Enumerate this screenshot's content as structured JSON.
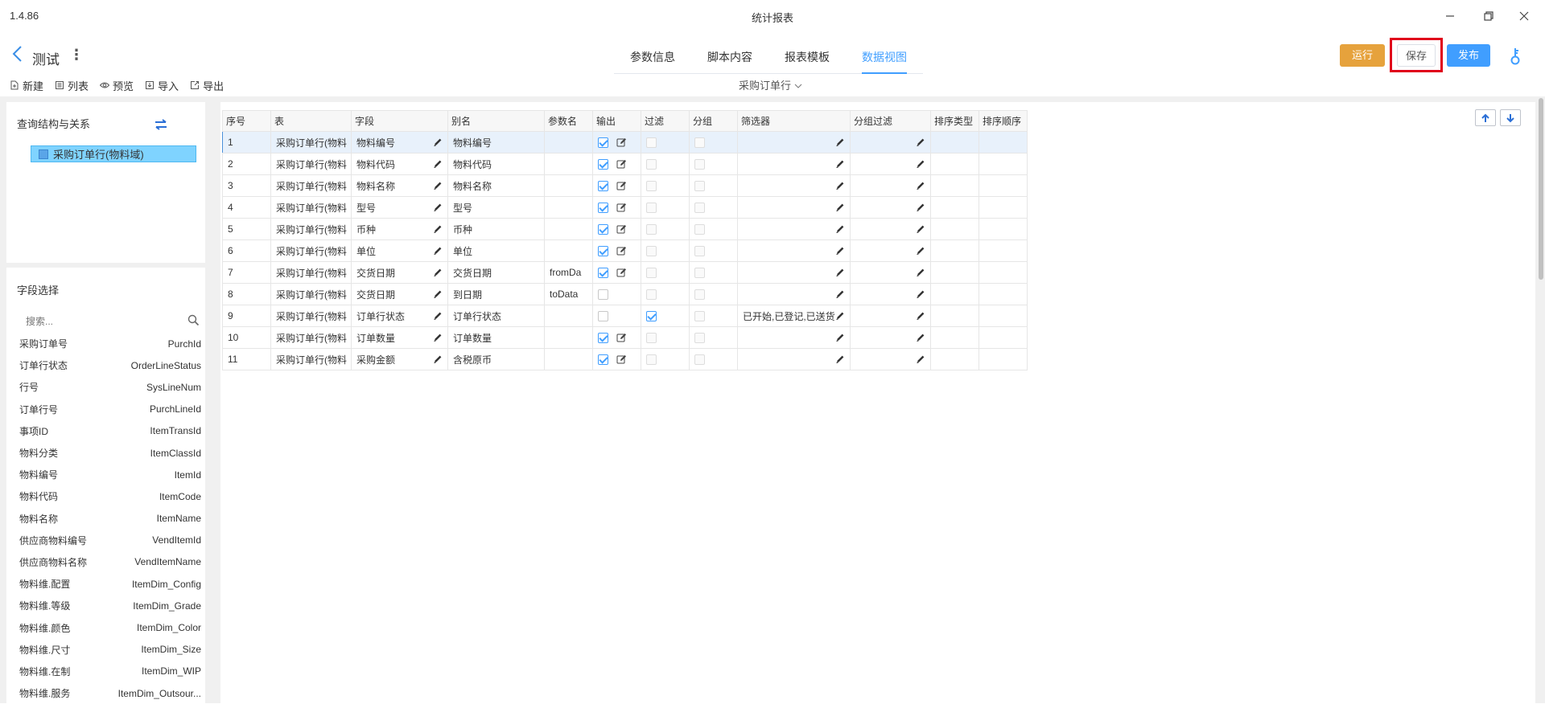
{
  "window": {
    "version": "1.4.86",
    "title": "统计报表"
  },
  "header": {
    "report_name": "测试",
    "tabs": [
      "参数信息",
      "脚本内容",
      "报表模板",
      "数据视图"
    ],
    "active_tab": "数据视图",
    "run_label": "运行",
    "save_label": "保存",
    "publish_label": "发布"
  },
  "toolbar": {
    "new": "新建",
    "list": "列表",
    "preview": "预览",
    "import": "导入",
    "export": "导出"
  },
  "view_select": "采购订单行",
  "left": {
    "query_title": "查询结构与关系",
    "tree_node": "采购订单行(物料域)",
    "field_title": "字段选择",
    "search_placeholder": "搜索...",
    "fields": [
      [
        "采购订单号",
        "PurchId"
      ],
      [
        "订单行状态",
        "OrderLineStatus"
      ],
      [
        "行号",
        "SysLineNum"
      ],
      [
        "订单行号",
        "PurchLineId"
      ],
      [
        "事项ID",
        "ItemTransId"
      ],
      [
        "物料分类",
        "ItemClassId"
      ],
      [
        "物料编号",
        "ItemId"
      ],
      [
        "物料代码",
        "ItemCode"
      ],
      [
        "物料名称",
        "ItemName"
      ],
      [
        "供应商物料编号",
        "VendItemId"
      ],
      [
        "供应商物料名称",
        "VendItemName"
      ],
      [
        "物料维.配置",
        "ItemDim_Config"
      ],
      [
        "物料维.等级",
        "ItemDim_Grade"
      ],
      [
        "物料维.颜色",
        "ItemDim_Color"
      ],
      [
        "物料维.尺寸",
        "ItemDim_Size"
      ],
      [
        "物料维.在制",
        "ItemDim_WIP"
      ],
      [
        "物料维.服务",
        "ItemDim_Outsour..."
      ]
    ]
  },
  "grid": {
    "columns": [
      "序号",
      "表",
      "字段",
      "别名",
      "参数名",
      "输出",
      "过滤",
      "分组",
      "筛选器",
      "分组过滤",
      "排序类型",
      "排序顺序"
    ],
    "rows": [
      {
        "no": "1",
        "table": "采购订单行(物料",
        "field": "物料编号",
        "alias": "物料编号",
        "param": "",
        "output": true,
        "filter": false,
        "group": false,
        "filterval": ""
      },
      {
        "no": "2",
        "table": "采购订单行(物料",
        "field": "物料代码",
        "alias": "物料代码",
        "param": "",
        "output": true,
        "filter": false,
        "group": false,
        "filterval": ""
      },
      {
        "no": "3",
        "table": "采购订单行(物料",
        "field": "物料名称",
        "alias": "物料名称",
        "param": "",
        "output": true,
        "filter": false,
        "group": false,
        "filterval": ""
      },
      {
        "no": "4",
        "table": "采购订单行(物料",
        "field": "型号",
        "alias": "型号",
        "param": "",
        "output": true,
        "filter": false,
        "group": false,
        "filterval": ""
      },
      {
        "no": "5",
        "table": "采购订单行(物料",
        "field": "币种",
        "alias": "币种",
        "param": "",
        "output": true,
        "filter": false,
        "group": false,
        "filterval": ""
      },
      {
        "no": "6",
        "table": "采购订单行(物料",
        "field": "单位",
        "alias": "单位",
        "param": "",
        "output": true,
        "filter": false,
        "group": false,
        "filterval": ""
      },
      {
        "no": "7",
        "table": "采购订单行(物料",
        "field": "交货日期",
        "alias": "交货日期",
        "param": "fromDa",
        "output": true,
        "filter": false,
        "group": false,
        "filterval": ""
      },
      {
        "no": "8",
        "table": "采购订单行(物料",
        "field": "交货日期",
        "alias": "到日期",
        "param": "toData",
        "output": false,
        "filter": false,
        "group": false,
        "filterval": ""
      },
      {
        "no": "9",
        "table": "采购订单行(物料",
        "field": "订单行状态",
        "alias": "订单行状态",
        "param": "",
        "output": false,
        "filter": true,
        "group": false,
        "filterval": "已开始,已登记,已送货"
      },
      {
        "no": "10",
        "table": "采购订单行(物料",
        "field": "订单数量",
        "alias": "订单数量",
        "param": "",
        "output": true,
        "filter": false,
        "group": false,
        "filterval": ""
      },
      {
        "no": "11",
        "table": "采购订单行(物料",
        "field": "采购金额",
        "alias": "含税原币",
        "param": "",
        "output": true,
        "filter": false,
        "group": false,
        "filterval": ""
      }
    ]
  }
}
